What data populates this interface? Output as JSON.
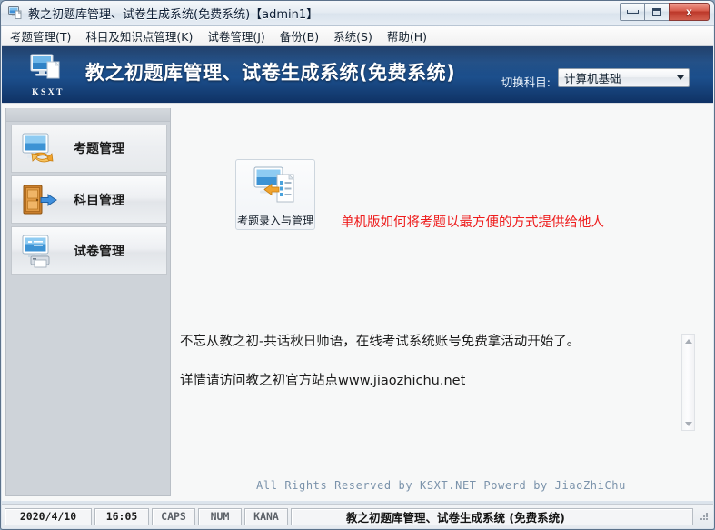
{
  "window": {
    "title": "教之初题库管理、试卷生成系统(免费系统)【admin1】",
    "icon": "app-monitor-icon",
    "controls": {
      "minimize": "minimize-icon",
      "maximize": "restore-icon",
      "close": "x"
    }
  },
  "menubar": {
    "items": [
      {
        "label": "考题管理(T)"
      },
      {
        "label": "科目及知识点管理(K)"
      },
      {
        "label": "试卷管理(J)"
      },
      {
        "label": "备份(B)"
      },
      {
        "label": "系统(S)"
      },
      {
        "label": "帮助(H)"
      }
    ]
  },
  "banner": {
    "logo_text": "KSXT",
    "logo_icon": "monitor-document-icon",
    "title": "教之初题库管理、试卷生成系统(免费系统)",
    "switch_label": "切换科目:",
    "subject_selected": "计算机基础",
    "bg_color": "#1c4f8c"
  },
  "sidebar": {
    "items": [
      {
        "label": "考题管理",
        "icon": "exam-sync-icon"
      },
      {
        "label": "科目管理",
        "icon": "door-arrow-icon"
      },
      {
        "label": "试卷管理",
        "icon": "monitor-printer-icon"
      }
    ]
  },
  "main": {
    "tile": {
      "label": "考题录入与管理",
      "icon": "monitor-list-import-icon"
    },
    "red_notice": "单机版如何将考题以最方便的方式提供给他人",
    "red_notice_color": "#ee1c1c",
    "notice_lines": [
      "不忘从教之初-共话秋日师语，在线考试系统账号免费拿活动开始了。",
      "详情请访问教之初官方站点www.jiaozhichu.net"
    ],
    "copyright": "All Rights Reserved by KSXT.NET Powerd by JiaoZhiChu",
    "copyright_color": "#7b93ab"
  },
  "statusbar": {
    "date": "2020/4/10",
    "time": "16:05",
    "caps": "CAPS",
    "num": "NUM",
    "kana": "KANA",
    "title": "教之初题库管理、试卷生成系统 (免费系统)"
  }
}
